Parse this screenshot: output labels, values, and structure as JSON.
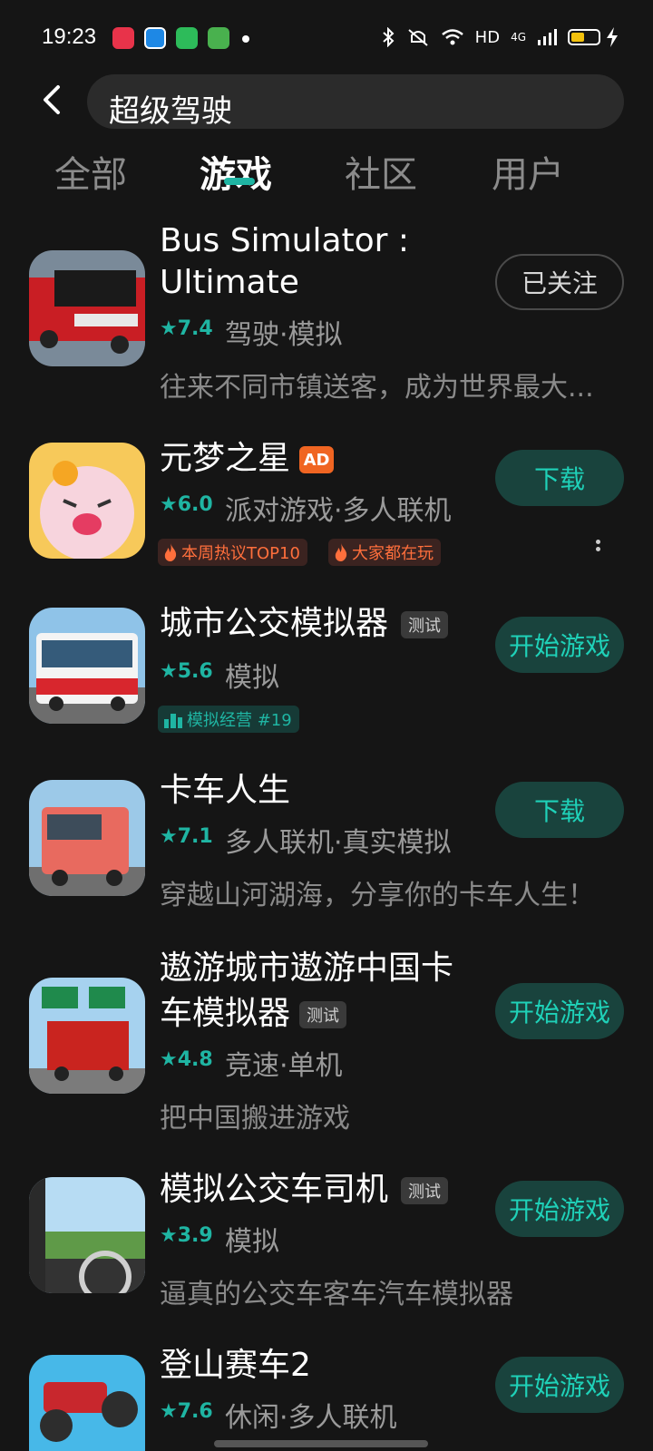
{
  "status": {
    "time": "19:23",
    "hd": "HD",
    "net": "4G"
  },
  "search": {
    "query": "超级驾驶"
  },
  "tabs": [
    {
      "label": "全部"
    },
    {
      "label": "游戏"
    },
    {
      "label": "社区"
    },
    {
      "label": "用户"
    }
  ],
  "games": [
    {
      "title_line1": "Bus Simulator :",
      "title_line2": "Ultimate",
      "rating": "7.4",
      "tags": "驾驶·模拟",
      "desc": "往来不同市镇送客，成为世界最大...",
      "action": "已关注"
    },
    {
      "title": "元梦之星",
      "badge": "AD",
      "rating": "6.0",
      "tags": "派对游戏·多人联机",
      "hot1": "本周热议TOP10",
      "hot2": "大家都在玩",
      "action": "下载"
    },
    {
      "title": "城市公交模拟器",
      "badge": "测试",
      "rating": "5.6",
      "tags": "模拟",
      "rank": "模拟经营 #19",
      "action": "开始游戏"
    },
    {
      "title": "卡车人生",
      "rating": "7.1",
      "tags": "多人联机·真实模拟",
      "desc": "穿越山河湖海，分享你的卡车人生！",
      "action": "下载"
    },
    {
      "title_line1": "遨游城市遨游中国卡",
      "title_line2": "车模拟器",
      "badge": "测试",
      "rating": "4.8",
      "tags": "竞速·单机",
      "desc": "把中国搬进游戏",
      "action": "开始游戏"
    },
    {
      "title": "模拟公交车司机",
      "badge": "测试",
      "rating": "3.9",
      "tags": "模拟",
      "desc": "逼真的公交车客车汽车模拟器",
      "action": "开始游戏"
    },
    {
      "title": "登山赛车2",
      "rating": "7.6",
      "tags": "休闲·多人联机",
      "action": "开始游戏"
    }
  ],
  "colors": {
    "accent": "#1fb5a3",
    "background": "#151515",
    "ad_badge": "#f06522"
  }
}
